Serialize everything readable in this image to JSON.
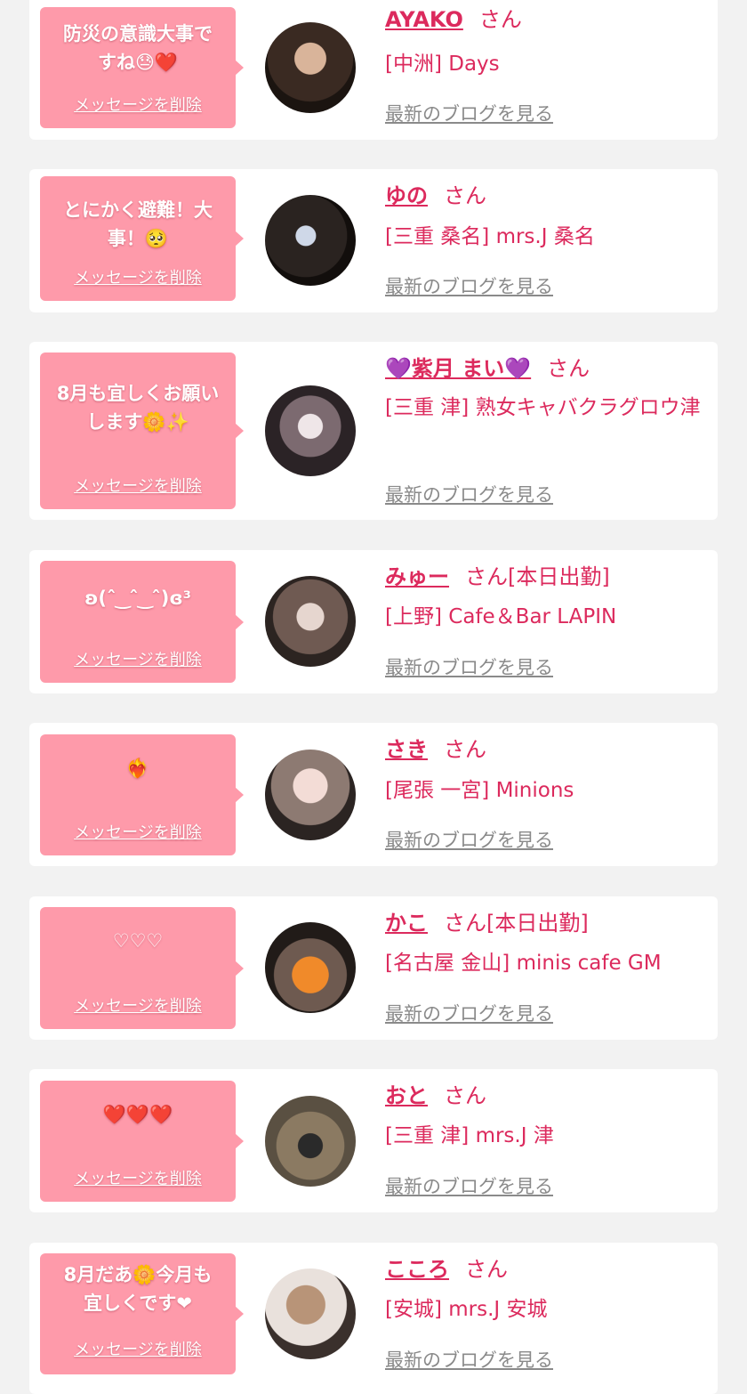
{
  "delete_label": "メッセージを削除",
  "blog_label": "最新のブログを見る",
  "san_label": "さん",
  "colors": {
    "accent": "#dc2a5d",
    "bubble": "#fe9aaa",
    "background": "#f2f2f2"
  },
  "items": [
    {
      "message_lines": [
        "防災の意識大事で",
        "すね😓❤️"
      ],
      "name": "AYAKO",
      "san": "さん",
      "shop": "[中洲] Days"
    },
    {
      "message_lines": [
        "とにかく避難！大",
        "事！🥺"
      ],
      "name": "ゆの",
      "san": "さん",
      "shop": "[三重 桑名] mrs.J 桑名"
    },
    {
      "message_lines": [
        "8月も宜しくお願い",
        "します🌼✨"
      ],
      "name": "💜紫月 まい💜",
      "san": "さん",
      "shop": "[三重 津] 熟女キャバクラグロウ津"
    },
    {
      "message_lines": [
        "ʚ(ˆ ͜ ˆ ͜ ˆ)ɞ³"
      ],
      "name": "みゅー",
      "san": "さん[本日出勤]",
      "shop": "[上野] Cafe＆Bar LAPIN"
    },
    {
      "message_lines": [
        "❤️‍🔥"
      ],
      "name": "さき",
      "san": "さん",
      "shop": "[尾張 一宮] Minions"
    },
    {
      "message_lines": [
        "♡♡♡"
      ],
      "name": "かこ",
      "san": "さん[本日出勤]",
      "shop": "[名古屋 金山] minis cafe GM"
    },
    {
      "message_lines": [
        "❤️❤️❤️"
      ],
      "name": "おと",
      "san": "さん",
      "shop": "[三重 津] mrs.J 津"
    },
    {
      "message_lines": [
        "8月だあ🌼今月も",
        "宜しくです❤"
      ],
      "name": "こころ",
      "san": "さん",
      "shop": "[安城] mrs.J 安城"
    }
  ]
}
